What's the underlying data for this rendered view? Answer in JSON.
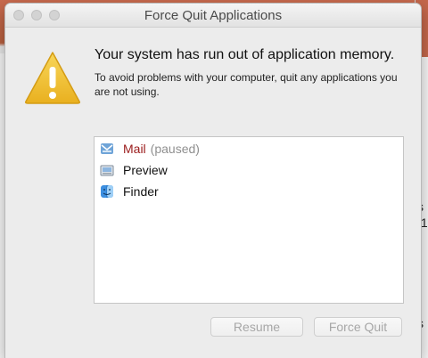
{
  "window": {
    "title": "Force Quit Applications"
  },
  "alert": {
    "headline": "Your system has run out of application memory.",
    "message": "To avoid problems with your computer, quit any applications you are not using."
  },
  "apps": [
    {
      "name": "Mail",
      "status": "(paused)",
      "icon": "mail-icon"
    },
    {
      "name": "Preview",
      "status": "",
      "icon": "preview-icon"
    },
    {
      "name": "Finder",
      "status": "",
      "icon": "finder-icon"
    }
  ],
  "buttons": {
    "resume": "Resume",
    "force_quit": "Force Quit"
  },
  "background": {
    "fragments": [
      "s",
      ":1",
      "s"
    ]
  },
  "colors": {
    "paused_app": "#9a1b1b",
    "warning": "#f2c12e"
  }
}
